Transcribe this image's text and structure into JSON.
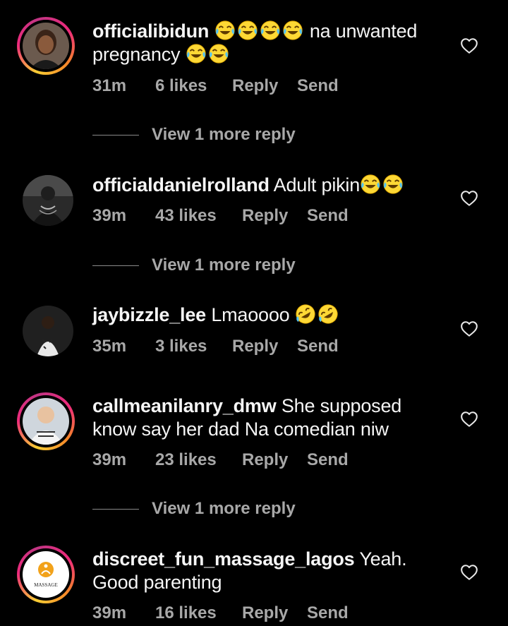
{
  "comments": [
    {
      "username": "officialibidun",
      "text": "na unwanted",
      "text_line2": "pregnancy",
      "time": "31m",
      "likes": "6 likes",
      "reply": "Reply",
      "send": "Send",
      "view_more": "View 1 more reply"
    },
    {
      "username": "officialdanielrolland",
      "text": "Adult pikin",
      "time": "39m",
      "likes": "43 likes",
      "reply": "Reply",
      "send": "Send",
      "view_more": "View 1 more reply"
    },
    {
      "username": "jaybizzle_lee",
      "text": "Lmaoooo",
      "time": "35m",
      "likes": "3 likes",
      "reply": "Reply",
      "send": "Send"
    },
    {
      "username": "callmeanilanry_dmw",
      "text": "She supposed",
      "text_line2": "know say her dad Na comedian niw",
      "time": "39m",
      "likes": "23 likes",
      "reply": "Reply",
      "send": "Send",
      "view_more": "View 1 more reply"
    },
    {
      "username": "discreet_fun_massage_lagos",
      "text": "Yeah.",
      "text_line2": "Good parenting",
      "avatar_logo_text": "MASSAGE",
      "time": "39m",
      "likes": "16 likes",
      "reply": "Reply",
      "send": "Send"
    }
  ],
  "icons": {
    "like": "heart-outline-icon",
    "emoji_tears": "face-with-tears-of-joy-icon",
    "emoji_rofl": "rolling-on-floor-laughing-icon"
  },
  "colors": {
    "background": "#000000",
    "text": "#f5f5f5",
    "secondary": "#a8a8a8",
    "emoji": "#fdd835"
  }
}
